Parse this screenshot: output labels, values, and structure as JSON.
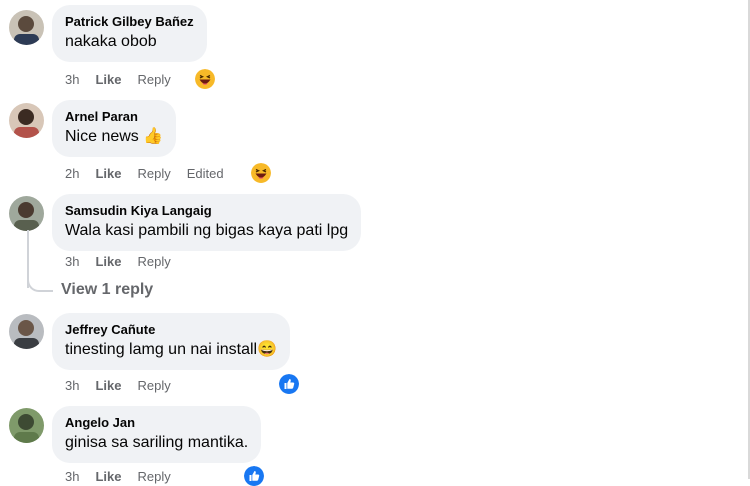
{
  "comments": [
    {
      "author": "Patrick Gilbey Bañez",
      "text": "nakaka obob",
      "time": "3h",
      "like": "Like",
      "reply": "Reply",
      "edited": "",
      "reaction": "haha"
    },
    {
      "author": "Arnel Paran",
      "text": "Nice news 👍",
      "time": "2h",
      "like": "Like",
      "reply": "Reply",
      "edited": "Edited",
      "reaction": "haha"
    },
    {
      "author": "Samsudin Kiya Langaig",
      "text": "Wala kasi pambili ng bigas kaya pati lpg",
      "time": "3h",
      "like": "Like",
      "reply": "Reply",
      "edited": "",
      "reaction": ""
    },
    {
      "author": "Jeffrey Cañute",
      "text": "tinesting lamg un nai install😄",
      "time": "3h",
      "like": "Like",
      "reply": "Reply",
      "edited": "",
      "reaction": "like"
    },
    {
      "author": "Angelo Jan",
      "text": "ginisa sa sariling mantika.",
      "time": "3h",
      "like": "Like",
      "reply": "Reply",
      "edited": "",
      "reaction": "like"
    }
  ],
  "view_replies": "View 1 reply",
  "colors": {
    "bubble": "#f0f2f5",
    "meta": "#65676b",
    "like_blue": "#1877f2",
    "haha_yellow": "#f7b928"
  }
}
